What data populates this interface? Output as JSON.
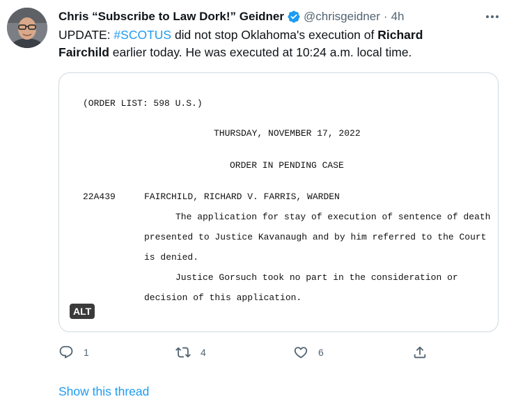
{
  "tweet": {
    "author_name": "Chris “Subscribe to Law Dork!” Geidner",
    "handle": "@chrisgeidner",
    "separator": "·",
    "time": "4h",
    "text": {
      "prefix": "UPDATE: ",
      "hashtag": "#SCOTUS",
      "mid": " did not stop Oklahoma's execution of ",
      "bold_name": "Richard Fairchild",
      "suffix": " earlier today. He was executed at 10:24 a.m. local time."
    },
    "media": {
      "alt_badge": "ALT",
      "document_lines": {
        "order_list": "(ORDER LIST:  598 U.S.)",
        "date": "THURSDAY, NOVEMBER 17, 2022",
        "heading": "ORDER IN PENDING CASE",
        "case_number": "22A439",
        "case_title": "FAIRCHILD, RICHARD V. FARRIS, WARDEN",
        "para1_line1": "The application for stay of execution of sentence of death",
        "para1_line2": "presented to Justice Kavanaugh and by him referred to the Court",
        "para1_line3": "is denied.",
        "para2_line1": "Justice Gorsuch took no part in the consideration or",
        "para2_line2": "decision of this application."
      }
    },
    "actions": {
      "reply_count": "1",
      "retweet_count": "4",
      "like_count": "6"
    },
    "show_thread_label": "Show this thread"
  },
  "icons": {
    "verified": "verified-badge-icon",
    "more": "more-options-icon",
    "reply": "reply-icon",
    "retweet": "retweet-icon",
    "like": "like-icon",
    "share": "share-icon"
  },
  "colors": {
    "accent": "#1d9bf0",
    "secondary_text": "#536471",
    "primary_text": "#0f1419",
    "border": "#cfd9de"
  }
}
